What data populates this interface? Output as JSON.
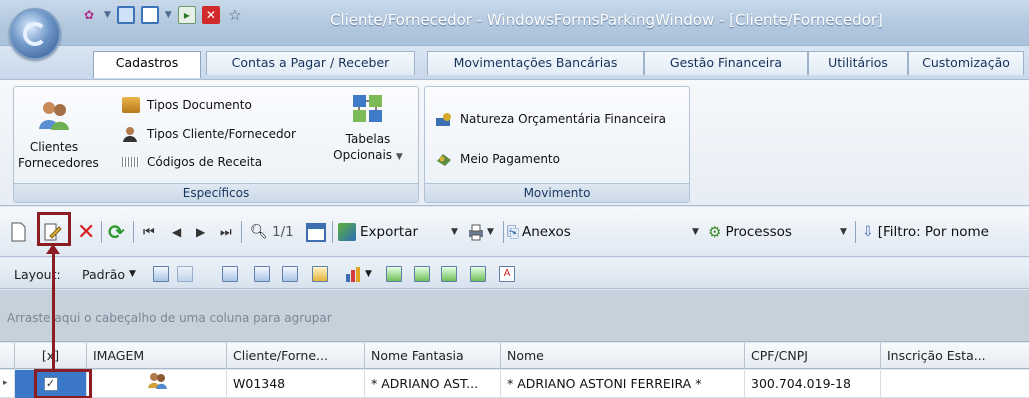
{
  "window": {
    "title": "Cliente/Fornecedor - WindowsFormsParkingWindow - [Cliente/Fornecedor]"
  },
  "tabs": [
    {
      "label": "Cadastros",
      "active": true
    },
    {
      "label": "Contas a Pagar / Receber",
      "active": false
    },
    {
      "label": "Movimentações Bancárias",
      "active": false
    },
    {
      "label": "Gestão Financeira",
      "active": false
    },
    {
      "label": "Utilitários",
      "active": false
    },
    {
      "label": "Customização",
      "active": false
    }
  ],
  "ribbon": {
    "especificos": {
      "label": "Específicos",
      "clientes_line1": "Clientes",
      "clientes_line2": "Fornecedores",
      "tipos_documento": "Tipos Documento",
      "tipos_cliente": "Tipos Cliente/Fornecedor",
      "codigos_receita": "Códigos de Receita",
      "tabelas_line1": "Tabelas",
      "tabelas_line2": "Opcionais"
    },
    "movimento": {
      "label": "Movimento",
      "natureza": "Natureza Orçamentária Financeira",
      "meio_pagamento": "Meio Pagamento"
    }
  },
  "toolbar": {
    "page": "1/1",
    "exportar": "Exportar",
    "anexos": "Anexos",
    "processos": "Processos",
    "filtro": "[Filtro: Por nome"
  },
  "layoutbar": {
    "layout": "Layout:",
    "padrao": "Padrão"
  },
  "grid": {
    "group_hint": "Arraste aqui o cabeçalho de uma coluna para agrupar",
    "columns": [
      "[x]",
      "IMAGEM",
      "Cliente/Forne...",
      "Nome Fantasia",
      "Nome",
      "CPF/CNPJ",
      "Inscrição Esta..."
    ],
    "rows": [
      {
        "codigo": "W01348",
        "fantasia": "* ADRIANO AST...",
        "nome": "* ADRIANO ASTONI FERREIRA *",
        "cpf": "300.704.019-18",
        "inscricao": "",
        "checked": true
      }
    ]
  },
  "colors": {
    "annotation": "#8b1d22",
    "title_text": "#ffffff",
    "ribbon_text": "#17365e"
  }
}
